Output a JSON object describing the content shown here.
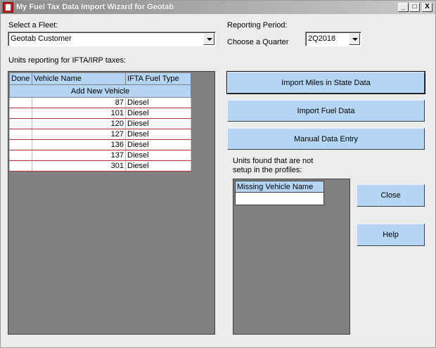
{
  "window": {
    "title": "My Fuel Tax Data Import Wizard for Geotab",
    "controls": [
      "_",
      "□",
      "X"
    ]
  },
  "fleet": {
    "label": "Select a Fleet:",
    "value": "Geotab Customer"
  },
  "period": {
    "label": "Reporting Period:",
    "quarter_label": "Choose a Quarter",
    "quarter_value": "2Q2018"
  },
  "units": {
    "label": "Units reporting for IFTA/IRP taxes:",
    "columns": [
      "Done",
      "Vehicle Name",
      "IFTA Fuel Type"
    ],
    "add_label": "Add New Vehicle",
    "rows": [
      {
        "done": "",
        "name": "87",
        "fuel": "Diesel"
      },
      {
        "done": "",
        "name": "101",
        "fuel": "Diesel"
      },
      {
        "done": "",
        "name": "120",
        "fuel": "Diesel"
      },
      {
        "done": "",
        "name": "127",
        "fuel": "Diesel"
      },
      {
        "done": "",
        "name": "136",
        "fuel": "Diesel"
      },
      {
        "done": "",
        "name": "137",
        "fuel": "Diesel"
      },
      {
        "done": "",
        "name": "301",
        "fuel": "Diesel"
      }
    ]
  },
  "actions": {
    "import_miles": "Import Miles in State Data",
    "import_fuel": "Import Fuel Data",
    "manual_entry": "Manual Data Entry",
    "close": "Close",
    "help": "Help"
  },
  "missing": {
    "label_line1": "Units found that are not",
    "label_line2": "setup in  the profiles:",
    "column": "Missing Vehicle Name"
  },
  "colors": {
    "button_fill": "#b5d5f5",
    "grid_background": "#808080",
    "row_separator": "#b03030"
  }
}
